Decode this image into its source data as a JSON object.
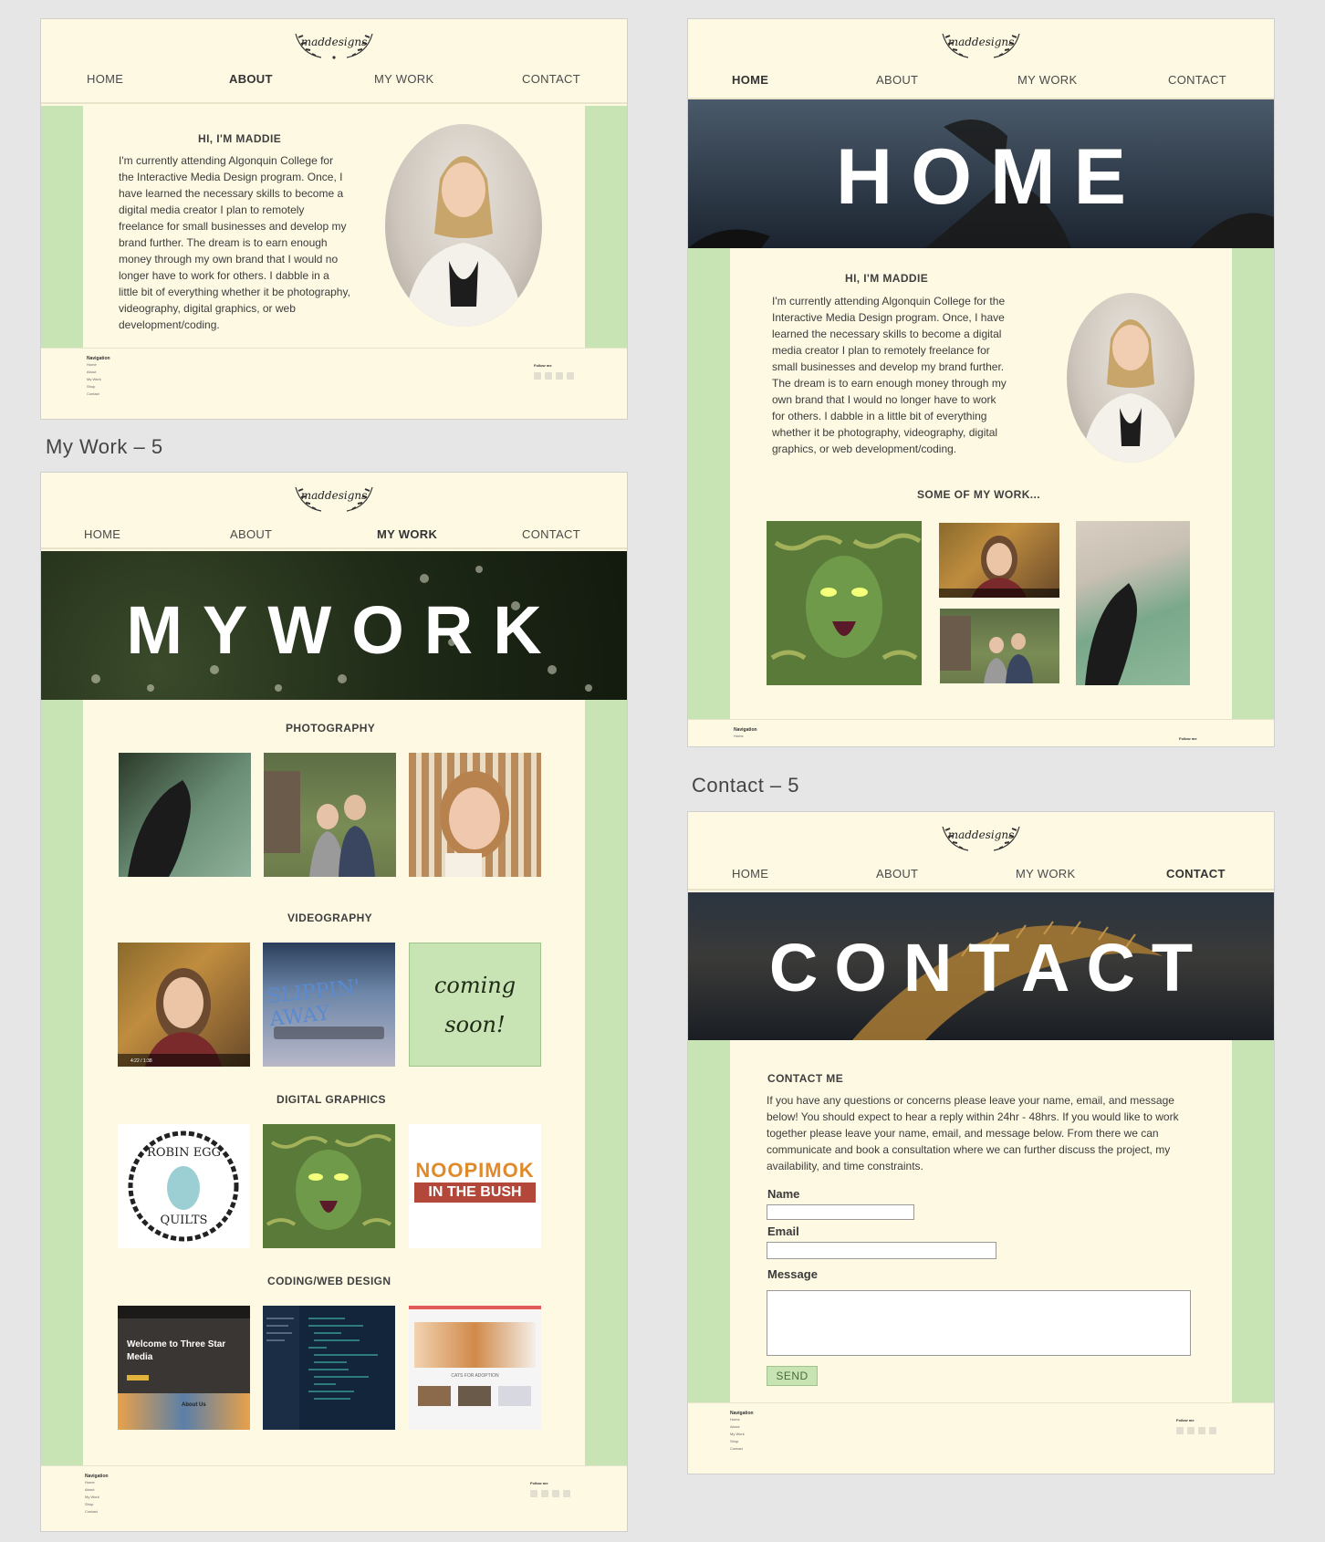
{
  "frames": {
    "about": {
      "nav": [
        "HOME",
        "ABOUT",
        "MY WORK",
        "CONTACT"
      ],
      "active": "ABOUT",
      "heading": "HI, I'M MADDIE",
      "bio": "I'm currently attending Algonquin College for the Interactive Media Design program. Once, I have learned the necessary skills to become a digital media creator I plan to remotely freelance for small businesses and develop my brand further. The dream is to earn enough money through my own brand that I would no longer have to work for others. I dabble in a little bit of everything whether it be photography, videography, digital graphics, or web development/coding."
    },
    "home": {
      "nav": [
        "HOME",
        "ABOUT",
        "MY WORK",
        "CONTACT"
      ],
      "active": "HOME",
      "hero": "HOME",
      "heading": "HI, I'M MADDIE",
      "bio": "I'm currently attending Algonquin College for the Interactive Media Design program. Once, I have learned the necessary skills to become a digital media creator I plan to remotely freelance for small businesses and develop my brand further. The dream is to earn enough money through my own brand that I would no longer have to work for others. I dabble in a little bit of everything whether it be photography, videography, digital graphics, or web development/coding.",
      "work_heading": "SOME OF MY WORK..."
    },
    "mywork": {
      "label": "My Work – 5",
      "nav": [
        "HOME",
        "ABOUT",
        "MY WORK",
        "CONTACT"
      ],
      "active": "MY WORK",
      "hero": "MYWORK",
      "sections": [
        "PHOTOGRAPHY",
        "VIDEOGRAPHY",
        "DIGITAL GRAPHICS",
        "CODING/WEB DESIGN"
      ],
      "coming_soon_1": "coming",
      "coming_soon_2": "soon!",
      "robin_top": "ROBIN EGG",
      "robin_bottom": "QUILTS",
      "noopimok_1": "NOOPIMOK",
      "noopimok_2": "IN THE BUSH",
      "three_star": "Welcome to Three Star Media",
      "about_us": "About Us",
      "cats": "CATS FOR ADOPTION",
      "video_slippin": "SLIPPIN' AWAY",
      "video_time": "4:22 / 1:38"
    },
    "contact": {
      "label": "Contact – 5",
      "nav": [
        "HOME",
        "ABOUT",
        "MY WORK",
        "CONTACT"
      ],
      "active": "CONTACT",
      "hero": "CONTACT",
      "heading": "CONTACT ME",
      "intro": "If you have any questions or concerns please leave your name, email, and message below! You should expect to hear a reply within 24hr - 48hrs. If you would like to work together please leave your name, email, and message below. From there we can communicate and book a consultation where we can further discuss the project, my availability, and time constraints.",
      "name_label": "Name",
      "email_label": "Email",
      "message_label": "Message",
      "send": "SEND"
    }
  },
  "logo": "maddesigns",
  "footer": {
    "nav_title": "Navigation",
    "links": [
      "Home",
      "About",
      "My Work",
      "Shop",
      "Contact"
    ],
    "follow": "Follow me"
  },
  "colors": {
    "cream": "#fdf9e3",
    "green": "#c8e4b4",
    "canvas": "#e6e6e6"
  }
}
